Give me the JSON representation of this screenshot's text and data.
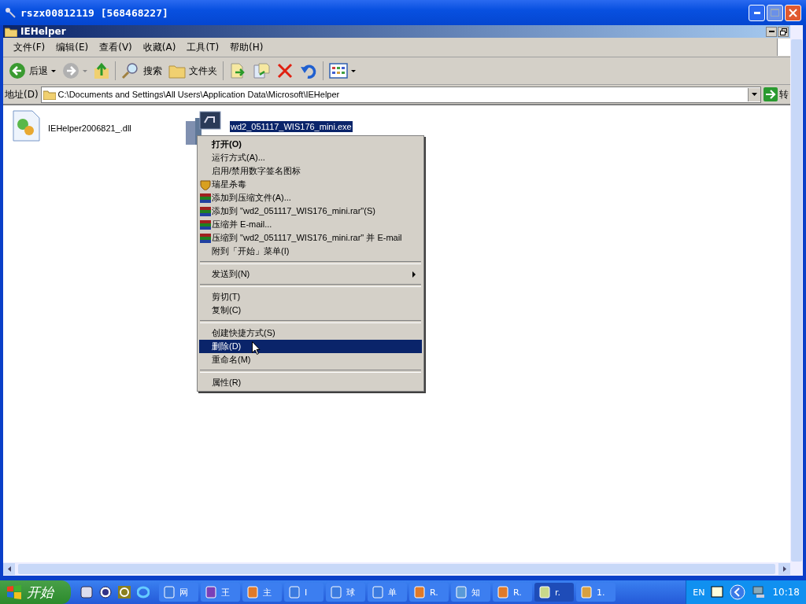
{
  "window": {
    "title": "rszx00812119 [568468227]"
  },
  "explorer": {
    "title": "IEHelper"
  },
  "menu_bar": [
    {
      "label": "文件(F)"
    },
    {
      "label": "编辑(E)"
    },
    {
      "label": "查看(V)"
    },
    {
      "label": "收藏(A)"
    },
    {
      "label": "工具(T)"
    },
    {
      "label": "帮助(H)"
    }
  ],
  "toolbar": {
    "back": "后退",
    "search": "搜索",
    "folders": "文件夹"
  },
  "address_bar": {
    "label": "地址(D)",
    "value": "C:\\Documents and Settings\\All Users\\Application Data\\Microsoft\\IEHelper",
    "go": "转"
  },
  "files": [
    {
      "name": "IEHelper2006821_.dll",
      "kind": "dll",
      "selected": false
    },
    {
      "name": "wd2_051117_WIS176_mini.exe",
      "kind": "exe",
      "selected": true
    }
  ],
  "context_menu": [
    {
      "kind": "item",
      "label": "打开(O)",
      "default": true,
      "selected": false
    },
    {
      "kind": "item",
      "label": "运行方式(A)...",
      "default": false,
      "selected": false
    },
    {
      "kind": "item",
      "label": "启用/禁用数字签名图标",
      "default": false,
      "selected": false
    },
    {
      "kind": "antivirus",
      "label": "瑞星杀毒",
      "default": false,
      "selected": false
    },
    {
      "kind": "archive",
      "label": "添加到压缩文件(A)...",
      "default": false,
      "selected": false
    },
    {
      "kind": "archive",
      "label": "添加到 \"wd2_051117_WIS176_mini.rar\"(S)",
      "default": false,
      "selected": false
    },
    {
      "kind": "archive",
      "label": "压缩并 E-mail...",
      "default": false,
      "selected": false
    },
    {
      "kind": "archive",
      "label": "压缩到 \"wd2_051117_WIS176_mini.rar\" 并 E-mail",
      "default": false,
      "selected": false
    },
    {
      "kind": "item",
      "label": "附到「开始」菜单(I)",
      "default": false,
      "selected": false
    },
    {
      "kind": "separator"
    },
    {
      "kind": "item",
      "label": "发送到(N)",
      "submenu": true,
      "default": false,
      "selected": false
    },
    {
      "kind": "separator"
    },
    {
      "kind": "item",
      "label": "剪切(T)",
      "default": false,
      "selected": false
    },
    {
      "kind": "item",
      "label": "复制(C)",
      "default": false,
      "selected": false
    },
    {
      "kind": "separator"
    },
    {
      "kind": "item",
      "label": "创建快捷方式(S)",
      "default": false,
      "selected": false
    },
    {
      "kind": "item",
      "label": "删除(D)",
      "default": false,
      "selected": true
    },
    {
      "kind": "item",
      "label": "重命名(M)",
      "default": false,
      "selected": false
    },
    {
      "kind": "separator"
    },
    {
      "kind": "item",
      "label": "属性(R)",
      "default": false,
      "selected": false
    }
  ],
  "taskbar": {
    "start": "开始",
    "tasks": [
      {
        "label": "网",
        "selected": false
      },
      {
        "label": "王",
        "selected": false
      },
      {
        "label": "主",
        "selected": false
      },
      {
        "label": "I",
        "selected": false
      },
      {
        "label": "球",
        "selected": false
      },
      {
        "label": "单",
        "selected": false
      },
      {
        "label": "R.",
        "selected": false
      },
      {
        "label": "知",
        "selected": false
      },
      {
        "label": "R.",
        "selected": false
      },
      {
        "label": "r.",
        "selected": true
      },
      {
        "label": "1.",
        "selected": false
      }
    ],
    "language": "EN",
    "clock": "10:18"
  }
}
